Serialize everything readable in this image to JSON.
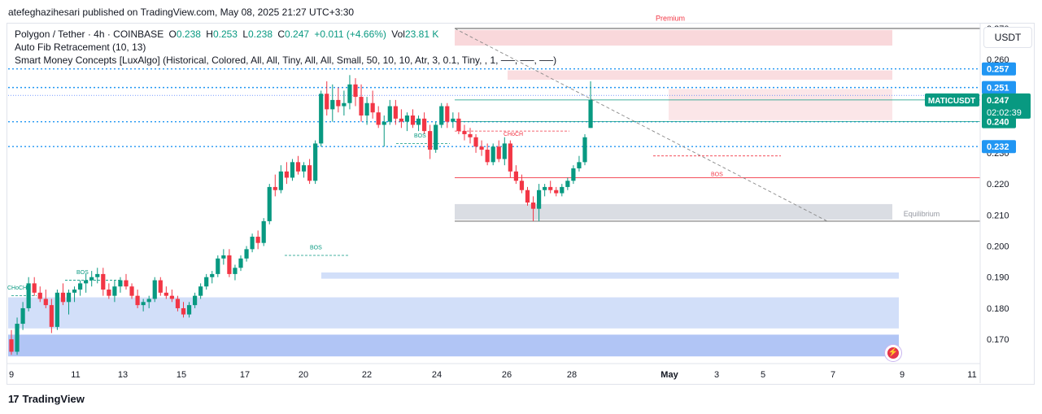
{
  "header": {
    "text": "atefeghazihesari published on TradingView.com, May 08, 2025 21:27 UTC+3:30"
  },
  "legend": {
    "symbol": "Polygon / Tether · 4h · COINBASE",
    "o_label": "O",
    "o_value": "0.238",
    "h_label": "H",
    "h_value": "0.253",
    "l_label": "L",
    "l_value": "0.238",
    "c_label": "C",
    "c_value": "0.247",
    "change": "+0.011 (+4.66%)",
    "vol_label": "Vol",
    "vol_value": "23.81 K",
    "indicator1": "Auto Fib Retracement (10, 13)",
    "indicator2": "Smart Money Concepts [LuxAlgo] (Historical, Colored, All, All, Tiny, All, All, Small, 50, 10, 10, Atr, 3, 0.1, Tiny, , 1, ──, ──, ──)"
  },
  "currency_button": "USDT",
  "brand": {
    "logo": "17",
    "name": "TradingView"
  },
  "colors": {
    "up": "#089981",
    "down": "#f23645",
    "blue": "#2962ff",
    "label_blue": "#2196f3"
  },
  "chart_data": {
    "type": "candlestick",
    "symbol": "MATICUSDT",
    "timeframe": "4h",
    "x_ticks": [
      "9",
      "11",
      "13",
      "15",
      "17",
      "20",
      "22",
      "24",
      "26",
      "28",
      "May",
      "3",
      "5",
      "7",
      "9",
      "11"
    ],
    "y_ticks": [
      "0.270",
      "0.260",
      "0.250",
      "0.240",
      "0.230",
      "0.220",
      "0.210",
      "0.200",
      "0.190",
      "0.180",
      "0.170"
    ],
    "ylim": [
      0.1635,
      0.2755
    ],
    "price_labels": [
      {
        "value": 0.257,
        "text": "0.257",
        "color": "#2196f3"
      },
      {
        "value": 0.251,
        "text": "0.251",
        "color": "#2196f3"
      },
      {
        "value": 0.24,
        "text": "0.240",
        "color": "#089981"
      },
      {
        "value": 0.232,
        "text": "0.232",
        "color": "#2196f3"
      }
    ],
    "last_price": {
      "symbol_label": "MATICUSDT",
      "value": "0.247",
      "countdown": "02:02:39",
      "color": "#089981"
    },
    "zone_labels": {
      "premium": "Premium",
      "equilibrium": "Equilibrium"
    },
    "structure_labels": [
      "BOS",
      "BOS",
      "BOS",
      "CHoCH",
      "BOS",
      "CHoCH"
    ],
    "candles": [
      [
        0.17,
        0.173,
        0.165,
        0.166
      ],
      [
        0.166,
        0.177,
        0.165,
        0.175
      ],
      [
        0.175,
        0.182,
        0.173,
        0.18
      ],
      [
        0.18,
        0.19,
        0.179,
        0.188
      ],
      [
        0.188,
        0.19,
        0.184,
        0.185
      ],
      [
        0.185,
        0.187,
        0.182,
        0.183
      ],
      [
        0.183,
        0.186,
        0.18,
        0.181
      ],
      [
        0.181,
        0.183,
        0.172,
        0.174
      ],
      [
        0.174,
        0.186,
        0.173,
        0.185
      ],
      [
        0.185,
        0.188,
        0.181,
        0.182
      ],
      [
        0.182,
        0.186,
        0.178,
        0.185
      ],
      [
        0.185,
        0.187,
        0.182,
        0.186
      ],
      [
        0.186,
        0.189,
        0.184,
        0.188
      ],
      [
        0.188,
        0.191,
        0.185,
        0.189
      ],
      [
        0.189,
        0.192,
        0.187,
        0.19
      ],
      [
        0.19,
        0.193,
        0.188,
        0.191
      ],
      [
        0.191,
        0.193,
        0.184,
        0.186
      ],
      [
        0.186,
        0.188,
        0.183,
        0.184
      ],
      [
        0.184,
        0.189,
        0.182,
        0.187
      ],
      [
        0.187,
        0.19,
        0.185,
        0.189
      ],
      [
        0.189,
        0.191,
        0.186,
        0.187
      ],
      [
        0.187,
        0.188,
        0.183,
        0.184
      ],
      [
        0.184,
        0.186,
        0.18,
        0.181
      ],
      [
        0.181,
        0.183,
        0.179,
        0.182
      ],
      [
        0.182,
        0.184,
        0.18,
        0.183
      ],
      [
        0.183,
        0.19,
        0.182,
        0.189
      ],
      [
        0.189,
        0.19,
        0.184,
        0.185
      ],
      [
        0.185,
        0.187,
        0.183,
        0.184
      ],
      [
        0.184,
        0.186,
        0.182,
        0.183
      ],
      [
        0.183,
        0.184,
        0.179,
        0.18
      ],
      [
        0.18,
        0.182,
        0.177,
        0.178
      ],
      [
        0.178,
        0.182,
        0.177,
        0.181
      ],
      [
        0.181,
        0.185,
        0.18,
        0.184
      ],
      [
        0.184,
        0.188,
        0.183,
        0.187
      ],
      [
        0.187,
        0.191,
        0.186,
        0.19
      ],
      [
        0.19,
        0.192,
        0.188,
        0.191
      ],
      [
        0.191,
        0.197,
        0.19,
        0.196
      ],
      [
        0.196,
        0.199,
        0.194,
        0.197
      ],
      [
        0.197,
        0.199,
        0.19,
        0.191
      ],
      [
        0.191,
        0.194,
        0.189,
        0.193
      ],
      [
        0.193,
        0.197,
        0.192,
        0.196
      ],
      [
        0.196,
        0.2,
        0.195,
        0.199
      ],
      [
        0.199,
        0.204,
        0.198,
        0.203
      ],
      [
        0.203,
        0.205,
        0.199,
        0.201
      ],
      [
        0.201,
        0.209,
        0.2,
        0.208
      ],
      [
        0.208,
        0.22,
        0.207,
        0.219
      ],
      [
        0.219,
        0.223,
        0.216,
        0.218
      ],
      [
        0.218,
        0.226,
        0.217,
        0.224
      ],
      [
        0.224,
        0.227,
        0.22,
        0.222
      ],
      [
        0.222,
        0.228,
        0.221,
        0.227
      ],
      [
        0.227,
        0.229,
        0.223,
        0.224
      ],
      [
        0.224,
        0.227,
        0.222,
        0.226
      ],
      [
        0.226,
        0.228,
        0.22,
        0.221
      ],
      [
        0.221,
        0.234,
        0.22,
        0.233
      ],
      [
        0.233,
        0.25,
        0.232,
        0.249
      ],
      [
        0.249,
        0.253,
        0.242,
        0.244
      ],
      [
        0.244,
        0.252,
        0.24,
        0.247
      ],
      [
        0.247,
        0.251,
        0.243,
        0.245
      ],
      [
        0.245,
        0.25,
        0.242,
        0.246
      ],
      [
        0.246,
        0.255,
        0.244,
        0.252
      ],
      [
        0.252,
        0.254,
        0.245,
        0.248
      ],
      [
        0.248,
        0.252,
        0.24,
        0.242
      ],
      [
        0.242,
        0.248,
        0.239,
        0.246
      ],
      [
        0.246,
        0.25,
        0.241,
        0.243
      ],
      [
        0.243,
        0.245,
        0.238,
        0.239
      ],
      [
        0.239,
        0.242,
        0.232,
        0.24
      ],
      [
        0.24,
        0.247,
        0.239,
        0.245
      ],
      [
        0.245,
        0.247,
        0.239,
        0.241
      ],
      [
        0.241,
        0.244,
        0.238,
        0.24
      ],
      [
        0.24,
        0.243,
        0.237,
        0.242
      ],
      [
        0.242,
        0.244,
        0.238,
        0.239
      ],
      [
        0.239,
        0.242,
        0.237,
        0.241
      ],
      [
        0.241,
        0.243,
        0.236,
        0.237
      ],
      [
        0.237,
        0.239,
        0.228,
        0.231
      ],
      [
        0.231,
        0.24,
        0.23,
        0.239
      ],
      [
        0.239,
        0.246,
        0.238,
        0.245
      ],
      [
        0.245,
        0.246,
        0.238,
        0.24
      ],
      [
        0.24,
        0.243,
        0.238,
        0.241
      ],
      [
        0.241,
        0.243,
        0.236,
        0.237
      ],
      [
        0.237,
        0.239,
        0.234,
        0.236
      ],
      [
        0.236,
        0.238,
        0.233,
        0.235
      ],
      [
        0.235,
        0.236,
        0.23,
        0.232
      ],
      [
        0.232,
        0.234,
        0.229,
        0.231
      ],
      [
        0.231,
        0.233,
        0.226,
        0.227
      ],
      [
        0.227,
        0.233,
        0.226,
        0.232
      ],
      [
        0.232,
        0.234,
        0.227,
        0.228
      ],
      [
        0.228,
        0.235,
        0.226,
        0.233
      ],
      [
        0.233,
        0.234,
        0.222,
        0.224
      ],
      [
        0.224,
        0.226,
        0.22,
        0.221
      ],
      [
        0.221,
        0.223,
        0.217,
        0.218
      ],
      [
        0.218,
        0.219,
        0.213,
        0.214
      ],
      [
        0.214,
        0.216,
        0.208,
        0.212
      ],
      [
        0.212,
        0.22,
        0.208,
        0.218
      ],
      [
        0.218,
        0.22,
        0.216,
        0.219
      ],
      [
        0.219,
        0.221,
        0.217,
        0.218
      ],
      [
        0.218,
        0.219,
        0.216,
        0.217
      ],
      [
        0.217,
        0.22,
        0.216,
        0.219
      ],
      [
        0.219,
        0.222,
        0.218,
        0.221
      ],
      [
        0.221,
        0.226,
        0.22,
        0.225
      ],
      [
        0.225,
        0.229,
        0.224,
        0.227
      ],
      [
        0.227,
        0.236,
        0.226,
        0.235
      ],
      [
        0.238,
        0.253,
        0.238,
        0.247
      ]
    ]
  }
}
